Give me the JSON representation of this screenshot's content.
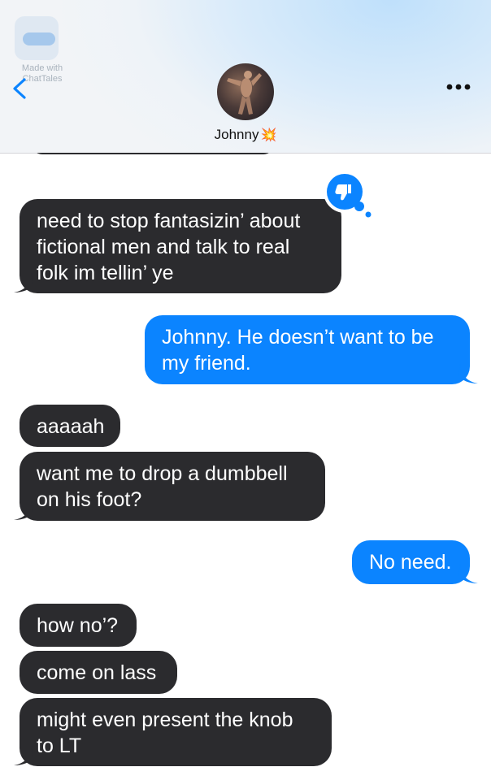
{
  "watermark": {
    "line1": "Made with",
    "line2": "ChatTales"
  },
  "header": {
    "contact_name": "Johnny",
    "name_emoji": "💥"
  },
  "colors": {
    "sent_bubble": "#0b84ff",
    "received_bubble": "#2b2b2e",
    "accent": "#0b84ff"
  },
  "messages": [
    {
      "side": "received",
      "text": "need to stop fantasizin’ about fictional men and talk to real folk im tellin’ ye"
    },
    {
      "side": "sent",
      "text": "Johnny. He doesn’t want to be my friend."
    },
    {
      "side": "received",
      "text": "aaaaah"
    },
    {
      "side": "received",
      "text": "want me to drop a dumbbell on his foot?"
    },
    {
      "side": "sent",
      "text": "No need."
    },
    {
      "side": "received",
      "text": "how no’?"
    },
    {
      "side": "received",
      "text": "come on lass"
    },
    {
      "side": "received",
      "text": "might even present the knob to LT"
    }
  ],
  "reaction": {
    "icon": "thumbs-down-icon"
  }
}
